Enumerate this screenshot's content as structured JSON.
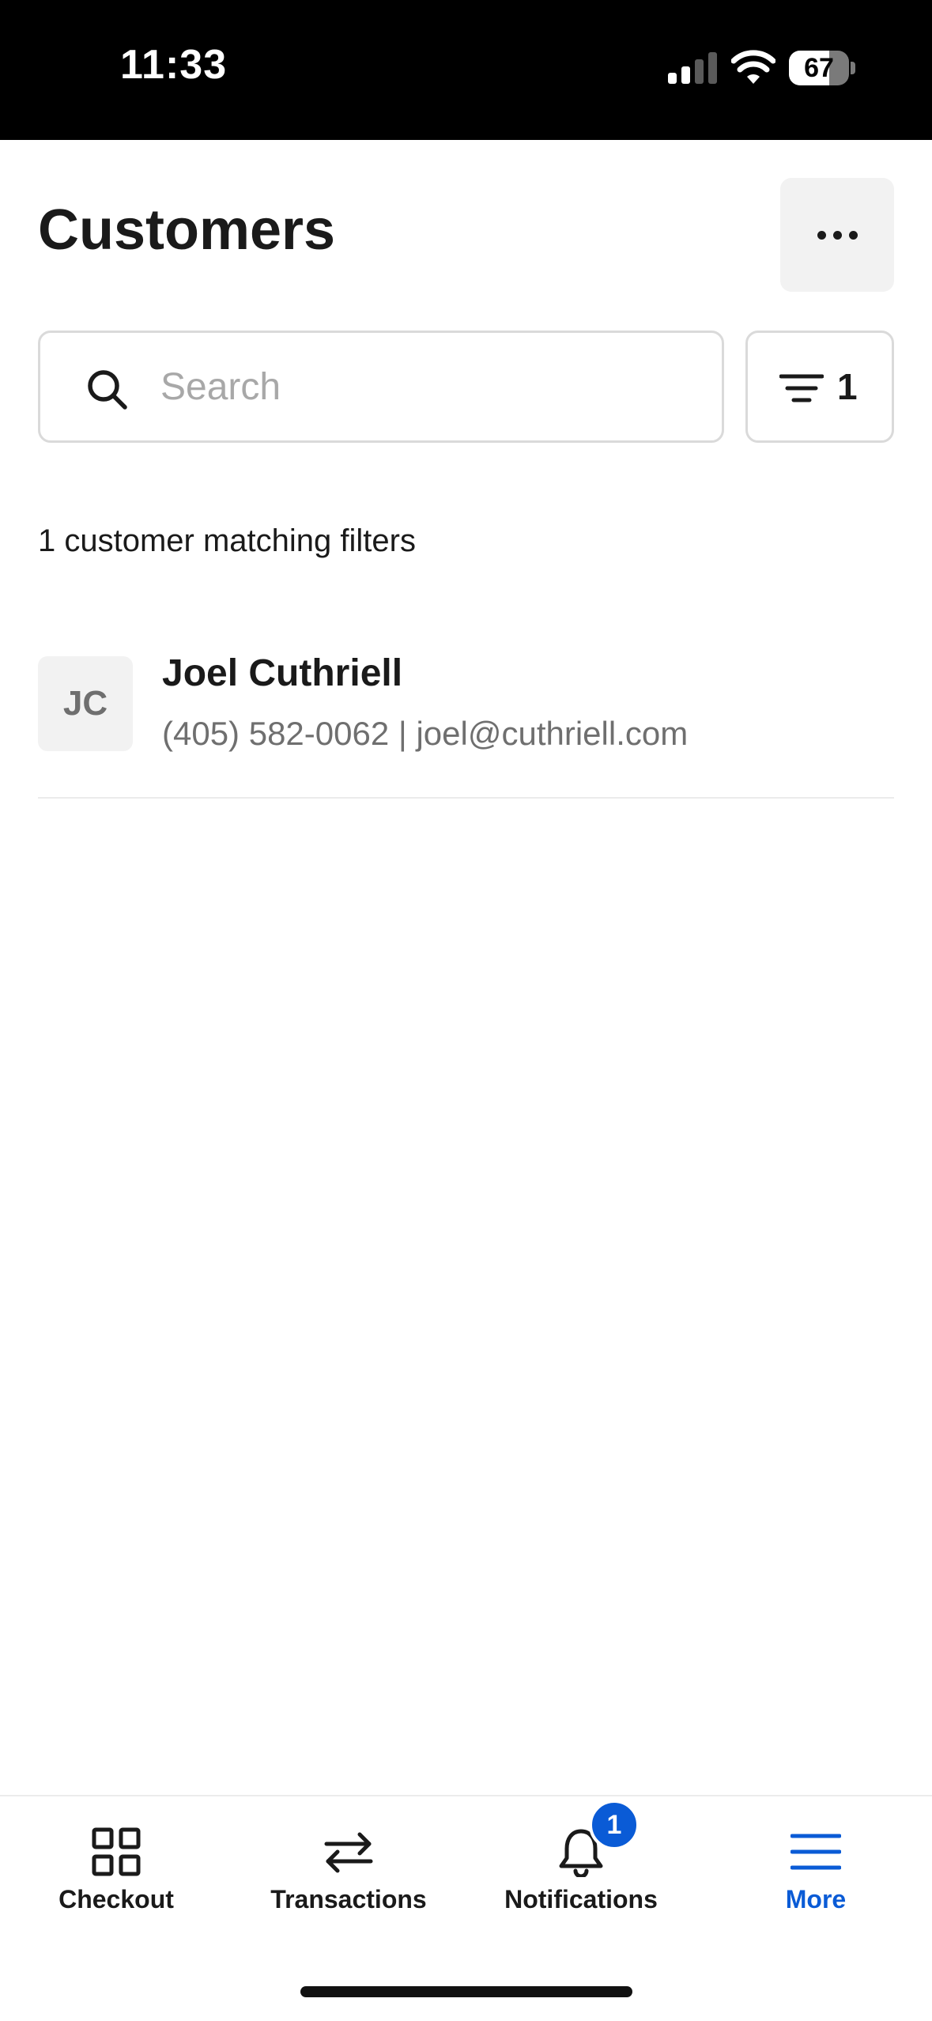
{
  "status_bar": {
    "time": "11:33",
    "battery_level": "67",
    "battery_fraction": 0.67
  },
  "header": {
    "title": "Customers",
    "more_icon": "ellipsis-icon"
  },
  "search": {
    "placeholder": "Search",
    "value": "",
    "icon": "search-icon"
  },
  "filter": {
    "icon": "filter-icon",
    "count": "1"
  },
  "results": {
    "summary": "1 customer matching filters",
    "customers": [
      {
        "initials": "JC",
        "name": "Joel Cuthriell",
        "details": "(405) 582-0062 | joel@cuthriell.com"
      }
    ]
  },
  "tab_bar": {
    "tabs": [
      {
        "label": "Checkout",
        "icon": "grid-icon",
        "active": false
      },
      {
        "label": "Transactions",
        "icon": "arrows-swap-icon",
        "active": false
      },
      {
        "label": "Notifications",
        "icon": "bell-icon",
        "active": false,
        "badge": "1"
      },
      {
        "label": "More",
        "icon": "menu-icon",
        "active": true
      }
    ]
  },
  "colors": {
    "accent": "#0a5bd6",
    "text_primary": "#1a1a1a",
    "text_secondary": "#6f6f6f",
    "surface": "#f2f2f2"
  }
}
